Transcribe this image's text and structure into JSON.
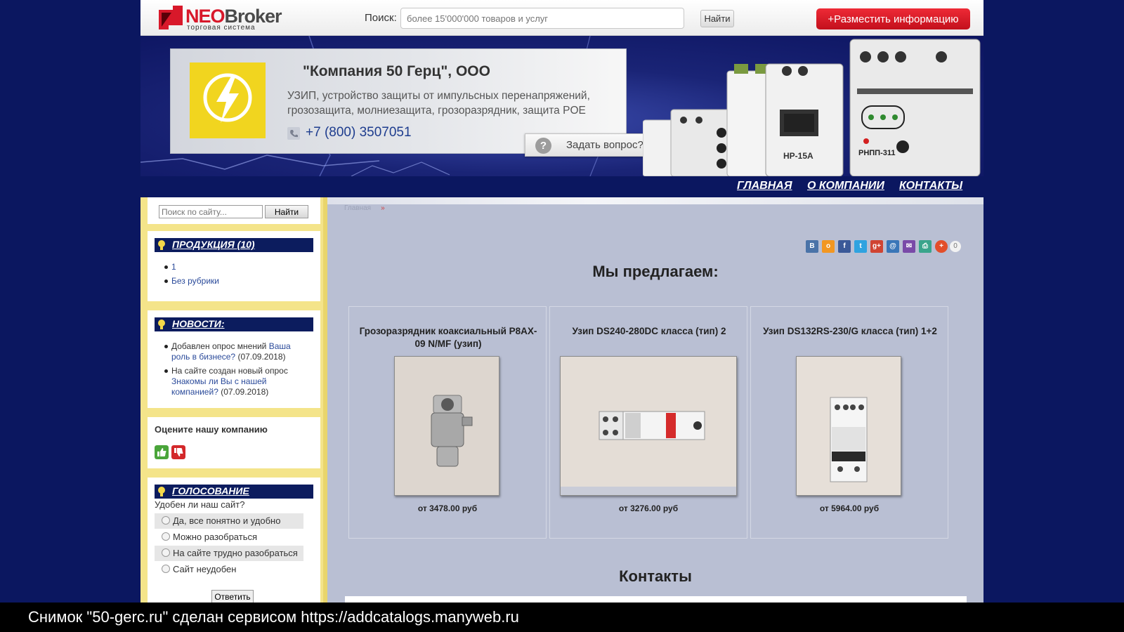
{
  "header": {
    "logo_main": "NEO",
    "logo_broker": "Broker",
    "logo_tagline": "торговая   система",
    "search_label": "Поиск:",
    "search_placeholder": "более 15'000'000 товаров и услуг",
    "search_button": "Найти",
    "post_button": "+Разместить информацию"
  },
  "banner": {
    "company_name": "\"Компания 50 Герц\", ООО",
    "description": "УЗИП, устройство защиты от импульсных перенапряжений, грозозащита, молниезащита, грозоразрядник, защита POE",
    "phone": "+7 (800) 3507051",
    "ask_button": "Задать вопрос?",
    "device_label_1": "НР-15А",
    "device_label_2": "РНПП-311"
  },
  "nav": {
    "items": [
      "ГЛАВНАЯ",
      "О КОМПАНИИ",
      "КОНТАКТЫ"
    ]
  },
  "sidebar": {
    "search_placeholder": "Поиск по сайту...",
    "search_button": "Найти",
    "products": {
      "title": "ПРОДУКЦИЯ (10)",
      "items": [
        "1",
        "Без рубрики"
      ]
    },
    "news": {
      "title": "НОВОСТИ:",
      "items": [
        {
          "prefix": "Добавлен опрос мнений ",
          "link": "Ваша роль в бизнесе?",
          "date": " (07.09.2018)"
        },
        {
          "prefix": "На сайте создан новый опрос ",
          "link": "Знакомы ли Вы с нашей компанией?",
          "date": " (07.09.2018)"
        }
      ]
    },
    "rating": {
      "title": "Оцените нашу компанию"
    },
    "poll": {
      "title": "ГОЛОСОВАНИЕ",
      "question": "Удобен ли наш сайт?",
      "options": [
        "Да, все понятно и удобно",
        "Можно разобраться",
        "На сайте трудно разобраться",
        "Сайт неудобен"
      ],
      "submit": "Ответить"
    }
  },
  "main": {
    "breadcrumb": "Главная",
    "breadcrumb_sep": "»",
    "share_icons": [
      "vk-icon",
      "odnoklassniki-icon",
      "facebook-icon",
      "twitter-icon",
      "google-plus-icon",
      "mail-ru-icon",
      "email-icon",
      "print-icon",
      "more-icon"
    ],
    "share_count": "0",
    "offer_heading": "Мы предлагаем:",
    "products": [
      {
        "title": "Грозоразрядник коаксиальный P8AX-09 N/MF (узип)",
        "price": "от 3478.00 руб"
      },
      {
        "title": "Узип DS240-280DC класса (тип) 2",
        "price": "от 3276.00 руб"
      },
      {
        "title": "Узип DS132RS-230/G класса (тип) 1+2",
        "price": "от 5964.00 руб"
      }
    ],
    "contacts_heading": "Контакты"
  },
  "caption": "Снимок \"50-gerc.ru\" сделан сервисом https://addcatalogs.manyweb.ru",
  "colors": {
    "background": "#0b1760",
    "accent_red": "#d8182a",
    "sidebar_yellow": "#f4e48a",
    "box_header": "#0c1c5e",
    "content_bg": "#b9bfd3"
  }
}
